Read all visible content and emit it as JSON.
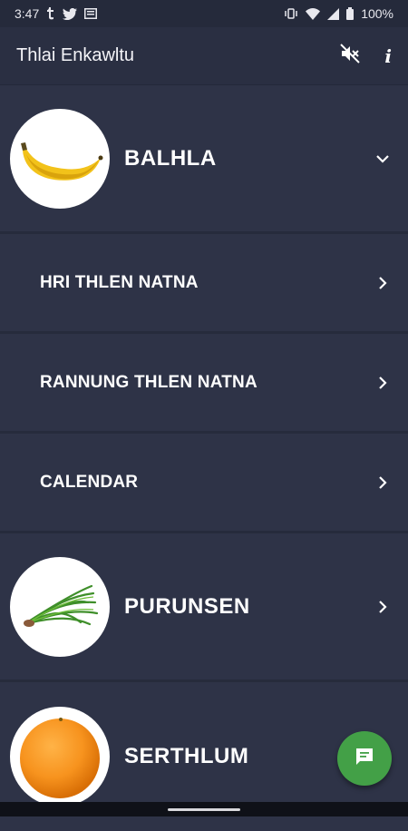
{
  "status_bar": {
    "time": "3:47",
    "battery": "100%"
  },
  "app_bar": {
    "title": "Thlai Enkawltu",
    "mute_icon": "volume-off-icon",
    "info_label": "i"
  },
  "items": [
    {
      "label": "BALHLA",
      "icon": "banana-image",
      "chevron": "chevron-down-icon"
    },
    {
      "label": "HRI THLEN NATNA",
      "chevron": "chevron-right-icon"
    },
    {
      "label": "RANNUNG THLEN NATNA",
      "chevron": "chevron-right-icon"
    },
    {
      "label": "CALENDAR",
      "chevron": "chevron-right-icon"
    },
    {
      "label": "PURUNSEN",
      "icon": "chives-image",
      "chevron": "chevron-right-icon"
    },
    {
      "label": "SERTHLUM",
      "icon": "orange-image"
    }
  ],
  "fab": {
    "icon": "chat-icon",
    "color": "#43a047"
  },
  "colors": {
    "background": "#2c3145",
    "app_bar": "#2a2f42",
    "status_bar": "#252a3b"
  }
}
